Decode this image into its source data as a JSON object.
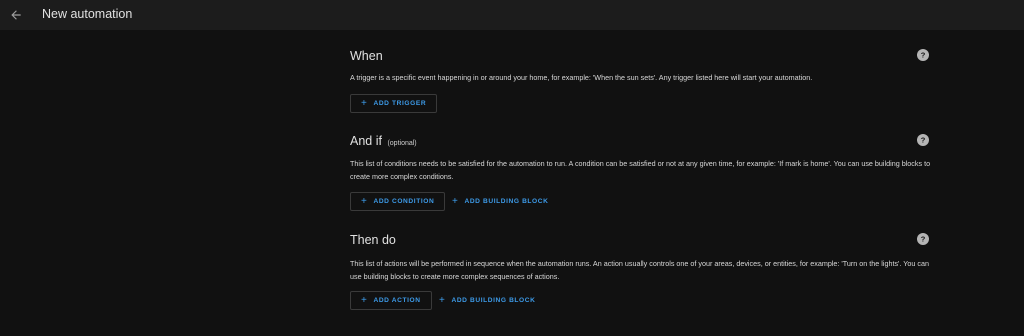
{
  "header": {
    "title": "New automation",
    "back_icon": "arrow-left-icon"
  },
  "sections": {
    "when": {
      "title": "When",
      "description": "A trigger is a specific event happening in or around your home, for example: 'When the sun sets'. Any trigger listed here will start your automation.",
      "add_button": "ADD TRIGGER"
    },
    "and_if": {
      "title": "And if",
      "optional_label": "(optional)",
      "description": "This list of conditions needs to be satisfied for the automation to run. A condition can be satisfied or not at any given time, for example: 'If mark is home'. You can use building blocks to create more complex conditions.",
      "add_button": "ADD CONDITION",
      "building_block_button": "ADD BUILDING BLOCK"
    },
    "then_do": {
      "title": "Then do",
      "description": "This list of actions will be performed in sequence when the automation runs. An action usually controls one of your areas, devices, or entities, for example: 'Turn on the lights'. You can use building blocks to create more complex sequences of actions.",
      "add_button": "ADD ACTION",
      "building_block_button": "ADD BUILDING BLOCK"
    }
  },
  "icons": {
    "plus": "+",
    "help": "help-circle-icon"
  },
  "colors": {
    "background": "#111111",
    "topbar": "#1c1c1c",
    "accent": "#3d9be9",
    "text": "#e1e1e1"
  }
}
